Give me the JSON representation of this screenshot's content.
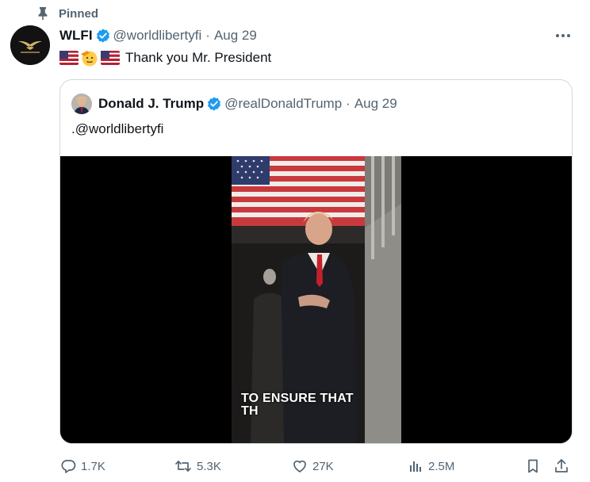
{
  "pinned": {
    "label": "Pinned",
    "icon": "pin-icon"
  },
  "tweet": {
    "author_name": "WLFI",
    "author_handle": "@worldlibertyfi",
    "separator": "·",
    "date": "Aug 29",
    "verified_icon": "verified-badge-icon",
    "text": "Thank you Mr. President",
    "emojis": [
      "us-flag-icon",
      "saluting-face-icon",
      "us-flag-icon"
    ]
  },
  "quote": {
    "author_name": "Donald J. Trump",
    "author_handle": "@realDonaldTrump",
    "separator": "·",
    "date": "Aug 29",
    "text": ".@worldlibertyfi",
    "video_caption_line1": "TO ENSURE THAT",
    "video_caption_line2": "TH"
  },
  "actions": {
    "replies": "1.7K",
    "reposts": "5.3K",
    "likes": "27K",
    "views": "2.5M"
  },
  "colors": {
    "text_primary": "#0f1419",
    "text_secondary": "#536471",
    "verified_blue": "#1d9bf0",
    "border": "#cfd9de"
  }
}
